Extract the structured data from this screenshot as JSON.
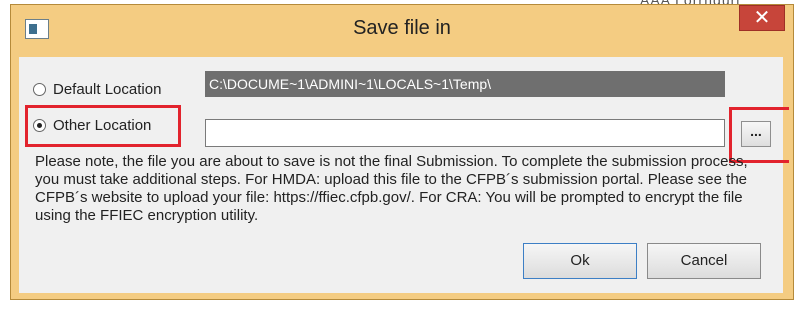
{
  "background": {
    "fragment_text": "AAA Lorrfiguri"
  },
  "dialog": {
    "title": "Save file in",
    "close_label": "✕",
    "default_location": {
      "label": "Default Location",
      "path": "C:\\DOCUME~1\\ADMINI~1\\LOCALS~1\\Temp\\",
      "selected": false
    },
    "other_location": {
      "label": "Other  Location",
      "value": "",
      "selected": true
    },
    "browse_label": "...",
    "note": "Please note, the file you are about to save is not the final Submission. To complete the submission process, you must take additional steps. For HMDA: upload this file to the CFPB´s submission portal. Please see the CFPB´s website to upload your file: https://ffiec.cfpb.gov/. For CRA: You will be prompted to encrypt the file using the FFIEC encryption utility.",
    "ok_label": "Ok",
    "cancel_label": "Cancel"
  },
  "colors": {
    "frame": "#f4cc82",
    "close_button": "#c7453a",
    "highlight": "#e2232d",
    "disabled_field": "#6f6f6f"
  }
}
